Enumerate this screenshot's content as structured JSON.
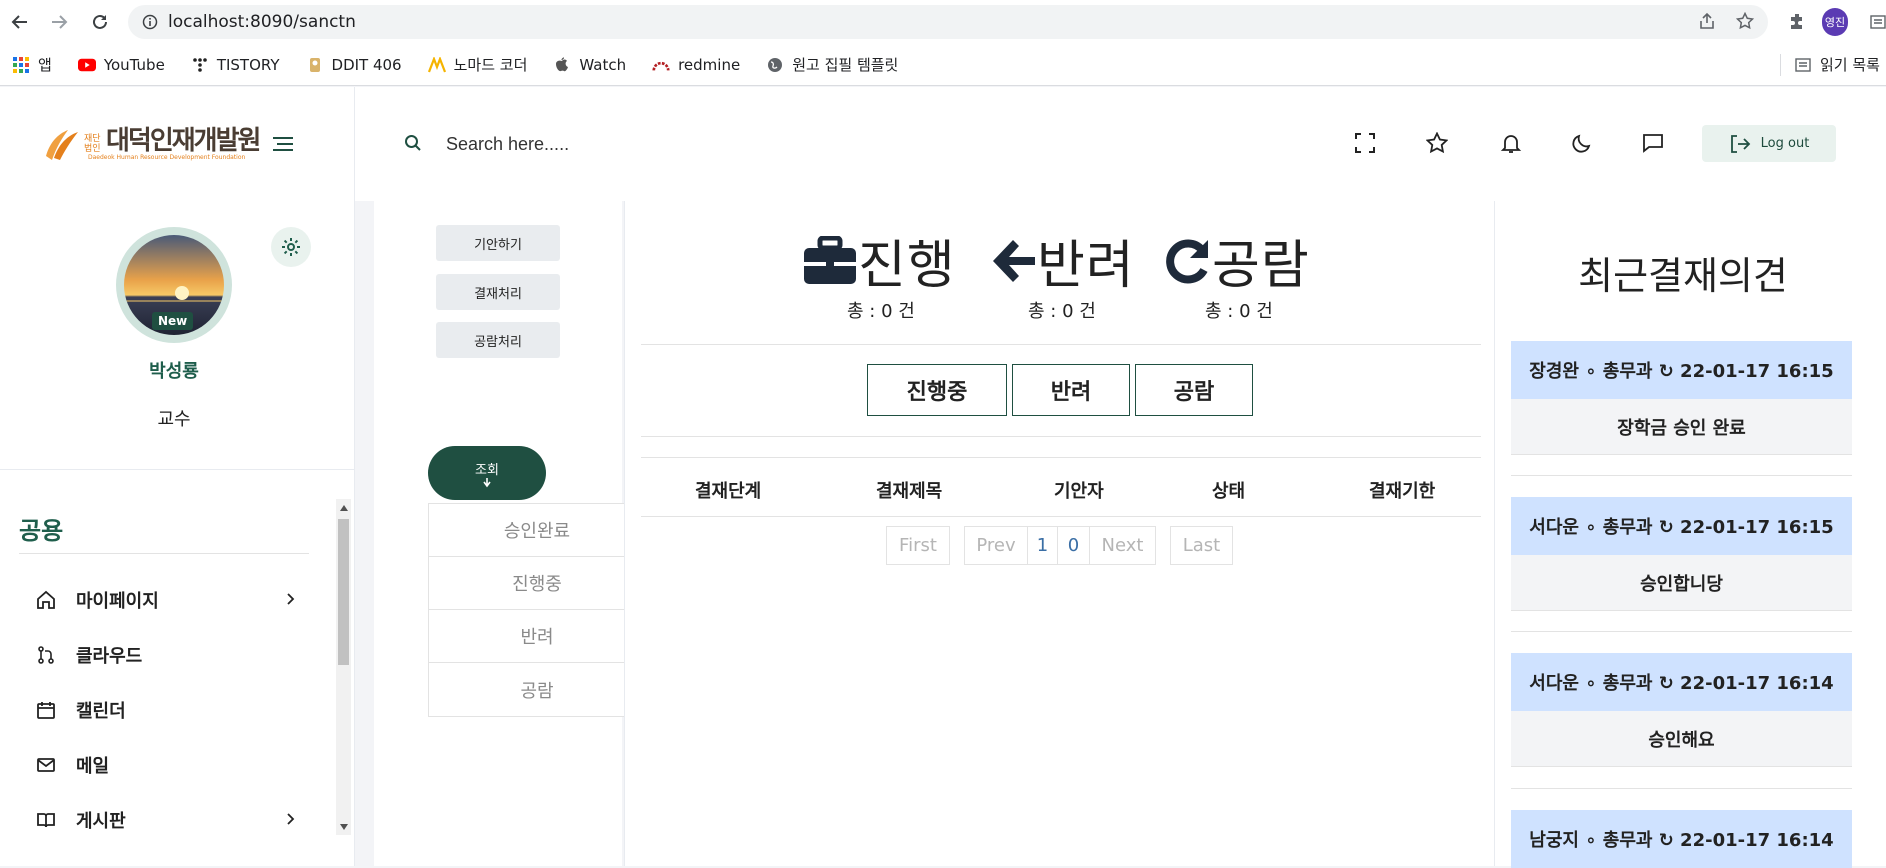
{
  "browser": {
    "url_host": "localhost:",
    "url_rest": "8090/sanctn",
    "profile_label": "영진",
    "reading_list": "읽기 목록"
  },
  "bookmarks": [
    {
      "label": "앱",
      "icon": "apps-grid-icon"
    },
    {
      "label": "YouTube",
      "icon": "youtube-icon"
    },
    {
      "label": "TISTORY",
      "icon": "tistory-icon"
    },
    {
      "label": "DDIT 406",
      "icon": "ddit-icon"
    },
    {
      "label": "노마드 코더",
      "icon": "nomad-coder-icon"
    },
    {
      "label": "Watch",
      "icon": "apple-icon"
    },
    {
      "label": "redmine",
      "icon": "redmine-icon"
    },
    {
      "label": "원고 집필 템플릿",
      "icon": "globe-icon"
    }
  ],
  "header": {
    "logo_text": "대덕인재개발원",
    "logo_prefix": "재단법인",
    "logo_sub": "Daedeok Human Resource Development Foundation",
    "search_placeholder": "Search here.....",
    "logout_label": "Log out"
  },
  "profile": {
    "badge": "New",
    "name": "박성룡",
    "role": "교수"
  },
  "sidebar": {
    "section_title": "공용",
    "items": [
      {
        "label": "마이페이지",
        "icon": "home-icon",
        "has_chevron": true
      },
      {
        "label": "클라우드",
        "icon": "git-branch-icon",
        "has_chevron": false
      },
      {
        "label": "캘린더",
        "icon": "calendar-icon",
        "has_chevron": false
      },
      {
        "label": "메일",
        "icon": "mail-icon",
        "has_chevron": false
      },
      {
        "label": "게시판",
        "icon": "book-icon",
        "has_chevron": true
      }
    ]
  },
  "subnav": {
    "draft": "기안하기",
    "process": "결재처리",
    "review": "공람처리",
    "lookup": "조회",
    "dropdown": [
      "승인완료",
      "진행중",
      "반려",
      "공람"
    ]
  },
  "stats": [
    {
      "icon": "briefcase-icon",
      "label": "진행",
      "count": "총 : 0 건"
    },
    {
      "icon": "arrow-left-icon",
      "label": "반려",
      "count": "총 : 0 건"
    },
    {
      "icon": "redo-icon",
      "label": "공람",
      "count": "총 : 0 건"
    }
  ],
  "filters": [
    "진행중",
    "반려",
    "공람"
  ],
  "table": {
    "headers": [
      "결재단계",
      "결재제목",
      "기안자",
      "상태",
      "결재기한"
    ]
  },
  "pager": {
    "first": "First",
    "prev": "Prev",
    "pages": [
      "1",
      "0"
    ],
    "next": "Next",
    "last": "Last"
  },
  "recent": {
    "title": "최근결재의견",
    "cards": [
      {
        "head": "장경완 ∘ 총무과 ↻ 22-01-17 16:15",
        "body": "장학금 승인 완료"
      },
      {
        "head": "서다운 ∘ 총무과 ↻ 22-01-17 16:15",
        "body": "승인합니당"
      },
      {
        "head": "서다운 ∘ 총무과 ↻ 22-01-17 16:14",
        "body": "승인해요"
      },
      {
        "head": "남궁지 ∘ 총무과 ↻ 22-01-17 16:14",
        "body": ""
      }
    ]
  },
  "colors": {
    "brand_dark_green": "#1f4f41",
    "accent_green": "#1f5e4c",
    "card_head_blue": "#cfe2ff"
  }
}
